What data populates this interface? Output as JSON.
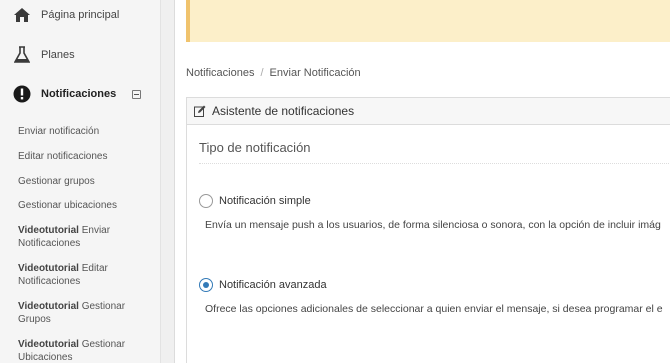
{
  "sidebar": {
    "items": [
      {
        "label": "Página principal",
        "icon": "home-icon"
      },
      {
        "label": "Planes",
        "icon": "flask-icon"
      },
      {
        "label": "Notificaciones",
        "icon": "exclamation-circle-icon"
      }
    ],
    "submenu": [
      {
        "label": "Enviar notificación"
      },
      {
        "label": "Editar notificaciones"
      },
      {
        "label": "Gestionar grupos"
      },
      {
        "label": "Gestionar ubicaciones"
      },
      {
        "prefix": "Videotutorial",
        "label": "Enviar Notificaciones"
      },
      {
        "prefix": "Videotutorial",
        "label": "Editar Notificaciones"
      },
      {
        "prefix": "Videotutorial",
        "label": "Gestionar Grupos"
      },
      {
        "prefix": "Videotutorial",
        "label": "Gestionar Ubicaciones"
      }
    ]
  },
  "breadcrumb": {
    "root": "Notificaciones",
    "separator": "/",
    "current": "Enviar Notificación"
  },
  "wizard": {
    "title": "Asistente de notificaciones",
    "section_title": "Tipo de notificación",
    "options": [
      {
        "label": "Notificación simple",
        "checked": false,
        "description": "Envía un mensaje push a los usuarios, de forma silenciosa o sonora, con la opción de incluir imág"
      },
      {
        "label": "Notificación avanzada",
        "checked": true,
        "description": "Ofrece las opciones adicionales de seleccionar a quien enviar el mensaje, si desea programar el e"
      }
    ]
  },
  "colors": {
    "alert_bg": "#fcefc9",
    "alert_border": "#f0c36d",
    "radio_accent": "#337ab7"
  }
}
